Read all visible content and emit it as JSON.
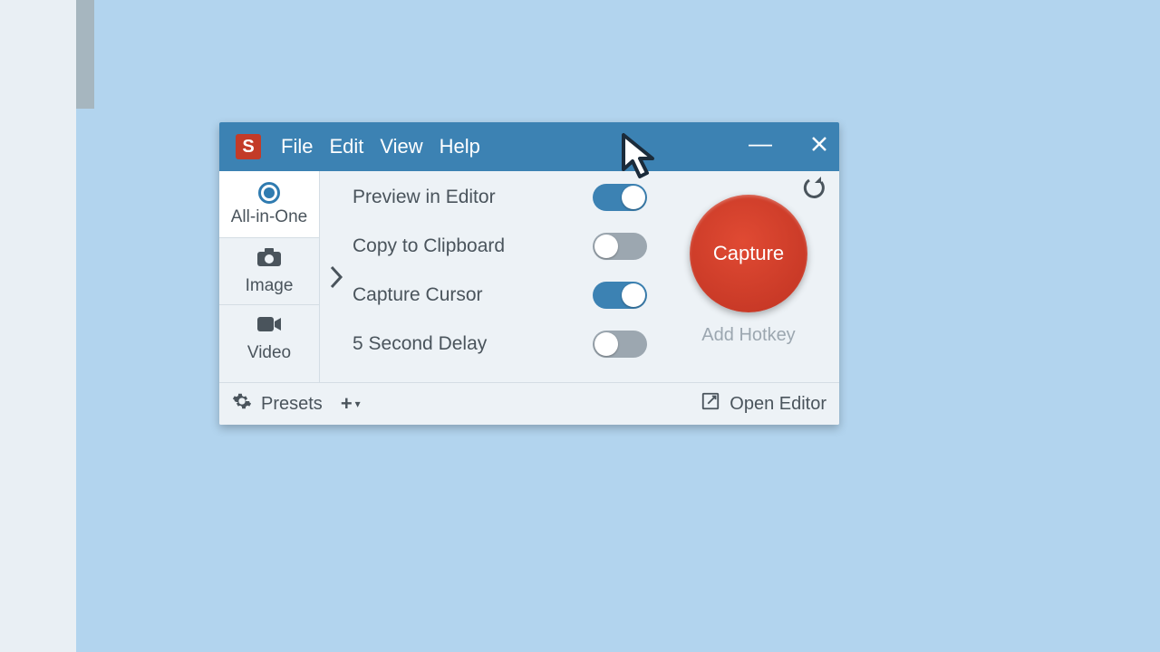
{
  "app": {
    "logo_letter": "S"
  },
  "menu": {
    "file": "File",
    "edit": "Edit",
    "view": "View",
    "help": "Help"
  },
  "sidebar": {
    "allinone": "All-in-One",
    "image": "Image",
    "video": "Video",
    "active": "allinone"
  },
  "options": {
    "preview": {
      "label": "Preview in Editor",
      "on": true
    },
    "clipboard": {
      "label": "Copy to Clipboard",
      "on": false
    },
    "cursor": {
      "label": "Capture Cursor",
      "on": true
    },
    "delay": {
      "label": "5 Second Delay",
      "on": false
    }
  },
  "capture": {
    "button": "Capture",
    "hotkey": "Add Hotkey"
  },
  "footer": {
    "presets": "Presets",
    "open_editor": "Open Editor"
  }
}
